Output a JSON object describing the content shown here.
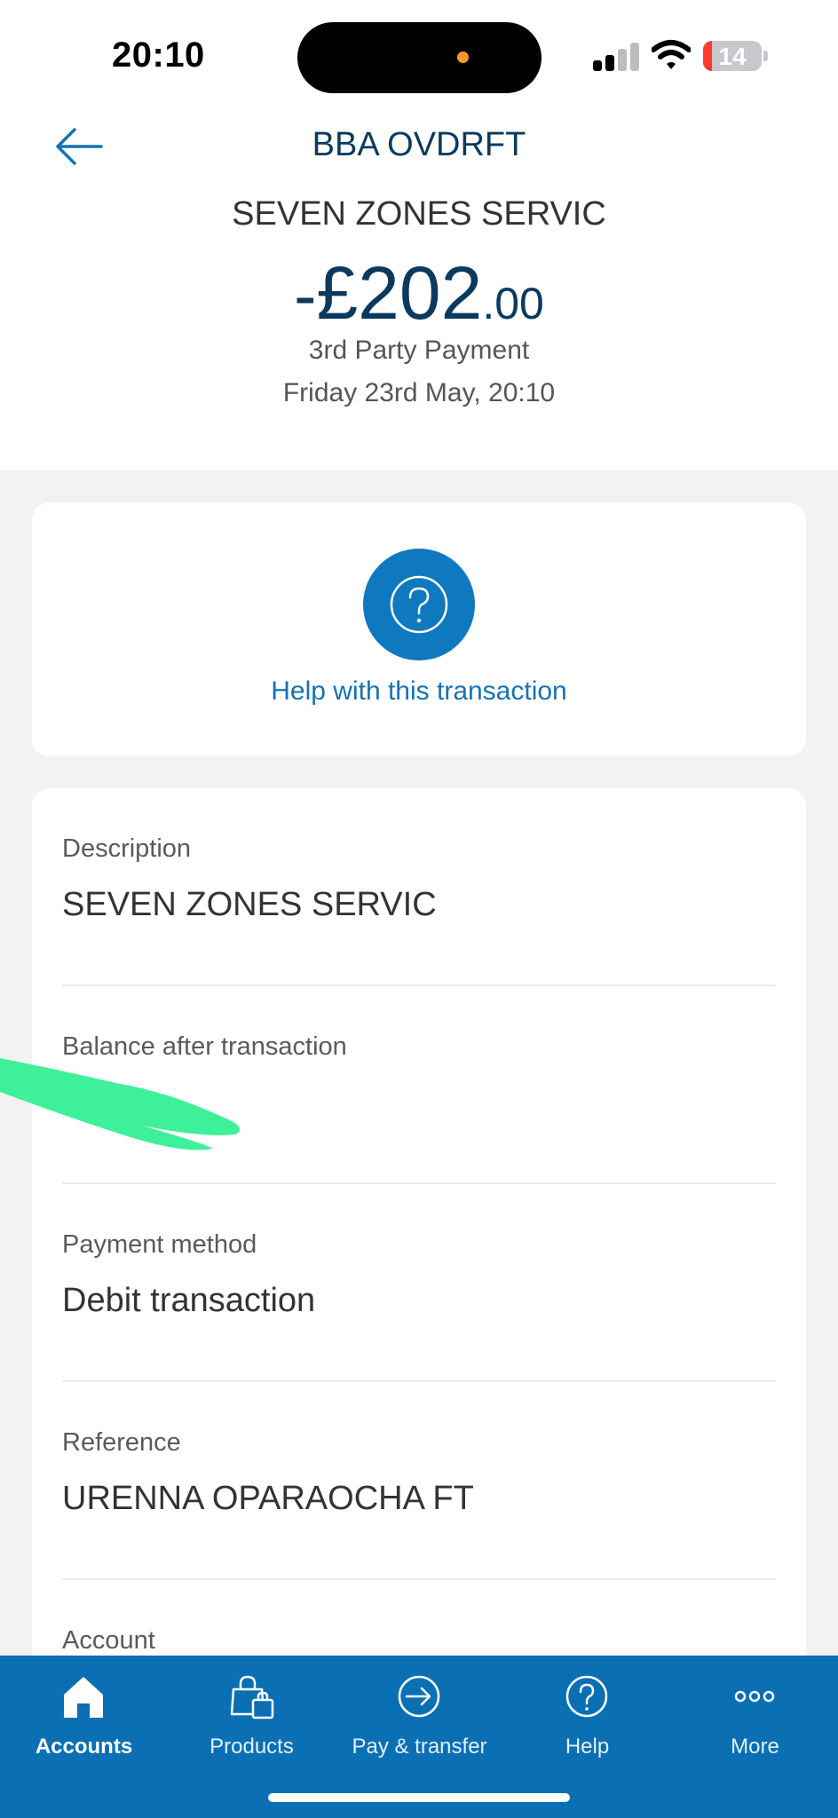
{
  "status_bar": {
    "time": "20:10",
    "battery": "14"
  },
  "header": {
    "account_title": "BBA OVDRFT",
    "payee": "SEVEN ZONES SERVIC",
    "amount_sign": "-",
    "amount_main": "£202",
    "amount_pence": ".00",
    "transaction_type": "3rd Party Payment",
    "date": "Friday 23rd May, 20:10"
  },
  "help": {
    "label": "Help with this transaction"
  },
  "details": [
    {
      "label": "Description",
      "value": "SEVEN ZONES SERVIC"
    },
    {
      "label": "Balance after transaction",
      "value": ""
    },
    {
      "label": "Payment method",
      "value": "Debit transaction"
    },
    {
      "label": "Reference",
      "value": "URENNA OPARAOCHA FT"
    },
    {
      "label": "Account",
      "value": ""
    }
  ],
  "tabs": [
    {
      "label": "Accounts",
      "icon": "home-icon",
      "active": true
    },
    {
      "label": "Products",
      "icon": "shopping-bag-icon",
      "active": false
    },
    {
      "label": "Pay & transfer",
      "icon": "transfer-arrow-icon",
      "active": false
    },
    {
      "label": "Help",
      "icon": "help-icon",
      "active": false
    },
    {
      "label": "More",
      "icon": "more-dots-icon",
      "active": false
    }
  ],
  "colors": {
    "brand_blue": "#0b6fb4",
    "title_navy": "#0b3a5e",
    "link_blue": "#1473b5",
    "redaction_green": "#3ef09a"
  }
}
